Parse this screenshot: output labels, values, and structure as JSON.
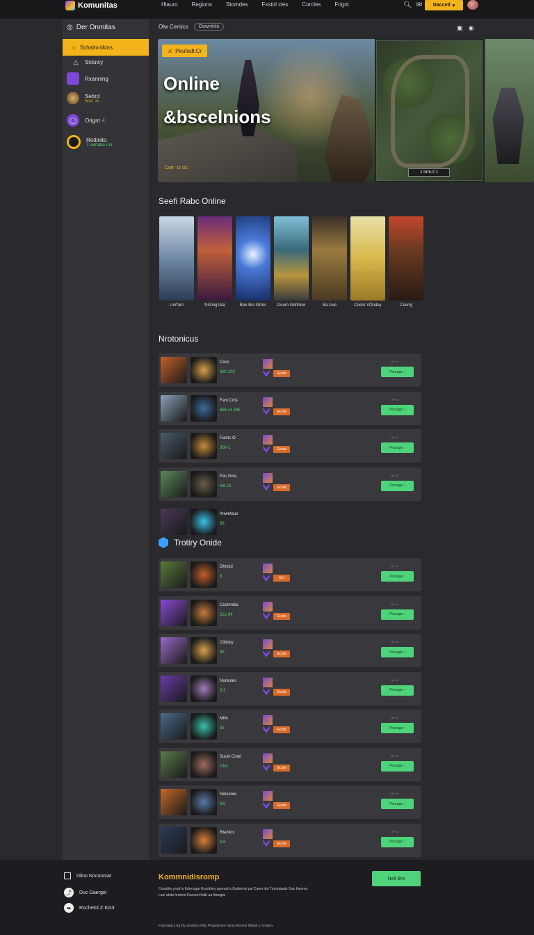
{
  "app": {
    "logo_text": "Komunitas"
  },
  "nav": [
    "Hlauro",
    "Regions",
    "Stomdes",
    "Fxstirl cles",
    "Corcles",
    "Frignt"
  ],
  "header": {
    "cta_label": "Naccetl"
  },
  "sidebar": {
    "title": "Der Onmitas",
    "active_label": "Schalmnikins",
    "items": [
      {
        "label": "Sntuicy",
        "sub": ""
      },
      {
        "label": "Rxanning",
        "sub": ""
      },
      {
        "label": "Sebrd",
        "sub": "Sclo ·lo"
      },
      {
        "label": "Orignt ·l",
        "sub": ""
      },
      {
        "label": "Rettinito",
        "sub": "7 vatrtaba c:ci"
      }
    ]
  },
  "main": {
    "header_label": "Olw Cemics",
    "header_pill": "Oowntnlo",
    "hero": {
      "tag": "Peufedl:Cr",
      "title_line1": "Online",
      "title_line2": "&bscelnions",
      "caption": "Cotr· ci.cic",
      "map_button": "1 Irrm.2 1"
    },
    "section1_title": "Seefi Rabc Online",
    "cards": [
      "Lmrfarn",
      "Nlcting lata",
      "Bee Bro Mrtes",
      "Duero Gehhew",
      "Ba Lwe",
      "Coem VOoday",
      "Coeng"
    ],
    "section2_title": "Nrotonicus",
    "section3_title": "Trotiry Onide",
    "row_button": "Pnurage",
    "row_meta": "cel·tcl",
    "rows2": [
      {
        "name": "Cocs",
        "sub": "836 209",
        "badge": "Gcctie"
      },
      {
        "name": "Fam Crits",
        "sub": "856 c4 495",
        "badge": "Gcctie"
      },
      {
        "name": "Fiams O",
        "sub": "306-1",
        "badge": "Gcctie"
      },
      {
        "name": "Fas Gnla",
        "sub": "Md 21",
        "badge": "Gcctie"
      },
      {
        "name": "Ariwetaus",
        "sub": "83",
        "badge": ""
      }
    ],
    "rows3": [
      {
        "name": "Dhrlcid",
        "sub": "8",
        "badge": "Gcl"
      },
      {
        "name": "Ccomnitia",
        "sub": "Dcs 94",
        "badge": "Gcctie"
      },
      {
        "name": "Cltlioby",
        "sub": "88",
        "badge": "Gcctie"
      },
      {
        "name": "Nureoles",
        "sub": "8.3",
        "badge": "Gcctie"
      },
      {
        "name": "Milis",
        "sub": "83",
        "badge": "Gcctie"
      },
      {
        "name": "Sucel Cotel",
        "sub": "Oloc",
        "badge": "Gcctie"
      },
      {
        "name": "Netsonia",
        "sub": "8.8",
        "badge": "Gcctie"
      },
      {
        "name": "Rtanlics",
        "sub": "8.8",
        "badge": "Gcctie"
      }
    ]
  },
  "footer": {
    "items": [
      "Dilno Noconmat",
      "Duc Gaergel",
      "Rochetnl·Z·KG3"
    ],
    "title": "Kommnidisromp",
    "text": "Coradhs ynud lo Edrmugar Rucdrlery panradi a Gaifeimts pal Caem ribt Tmolnpaals Gan Ilamma Lael ahda hniemd Dumerd Ihdb ua Atmqpis",
    "note": "Impmaidcs da Dy smulrlon hldy Pmpebmen Istras Remmi Wlaell u Chdam.",
    "button": "Neil Bre"
  },
  "colors": {
    "accent": "#f2b31b",
    "success": "#4fd37a",
    "badge": "#d66b2a"
  }
}
